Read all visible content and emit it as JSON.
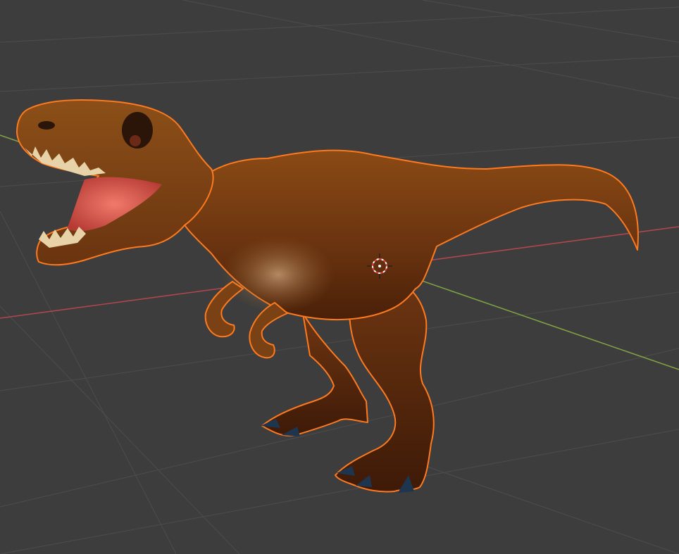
{
  "viewport": {
    "background": "#3d3d3d",
    "grid_color": "#4a4a4a",
    "x_axis_color": "#b0474f",
    "y_axis_color": "#7ea043"
  },
  "object": {
    "kind": "t-rex model",
    "selected": true,
    "outline_color": "#ff7a1f"
  },
  "cursor": {
    "icon": "3d-cursor-icon",
    "colors": [
      "#ffffff",
      "#e04040"
    ]
  }
}
